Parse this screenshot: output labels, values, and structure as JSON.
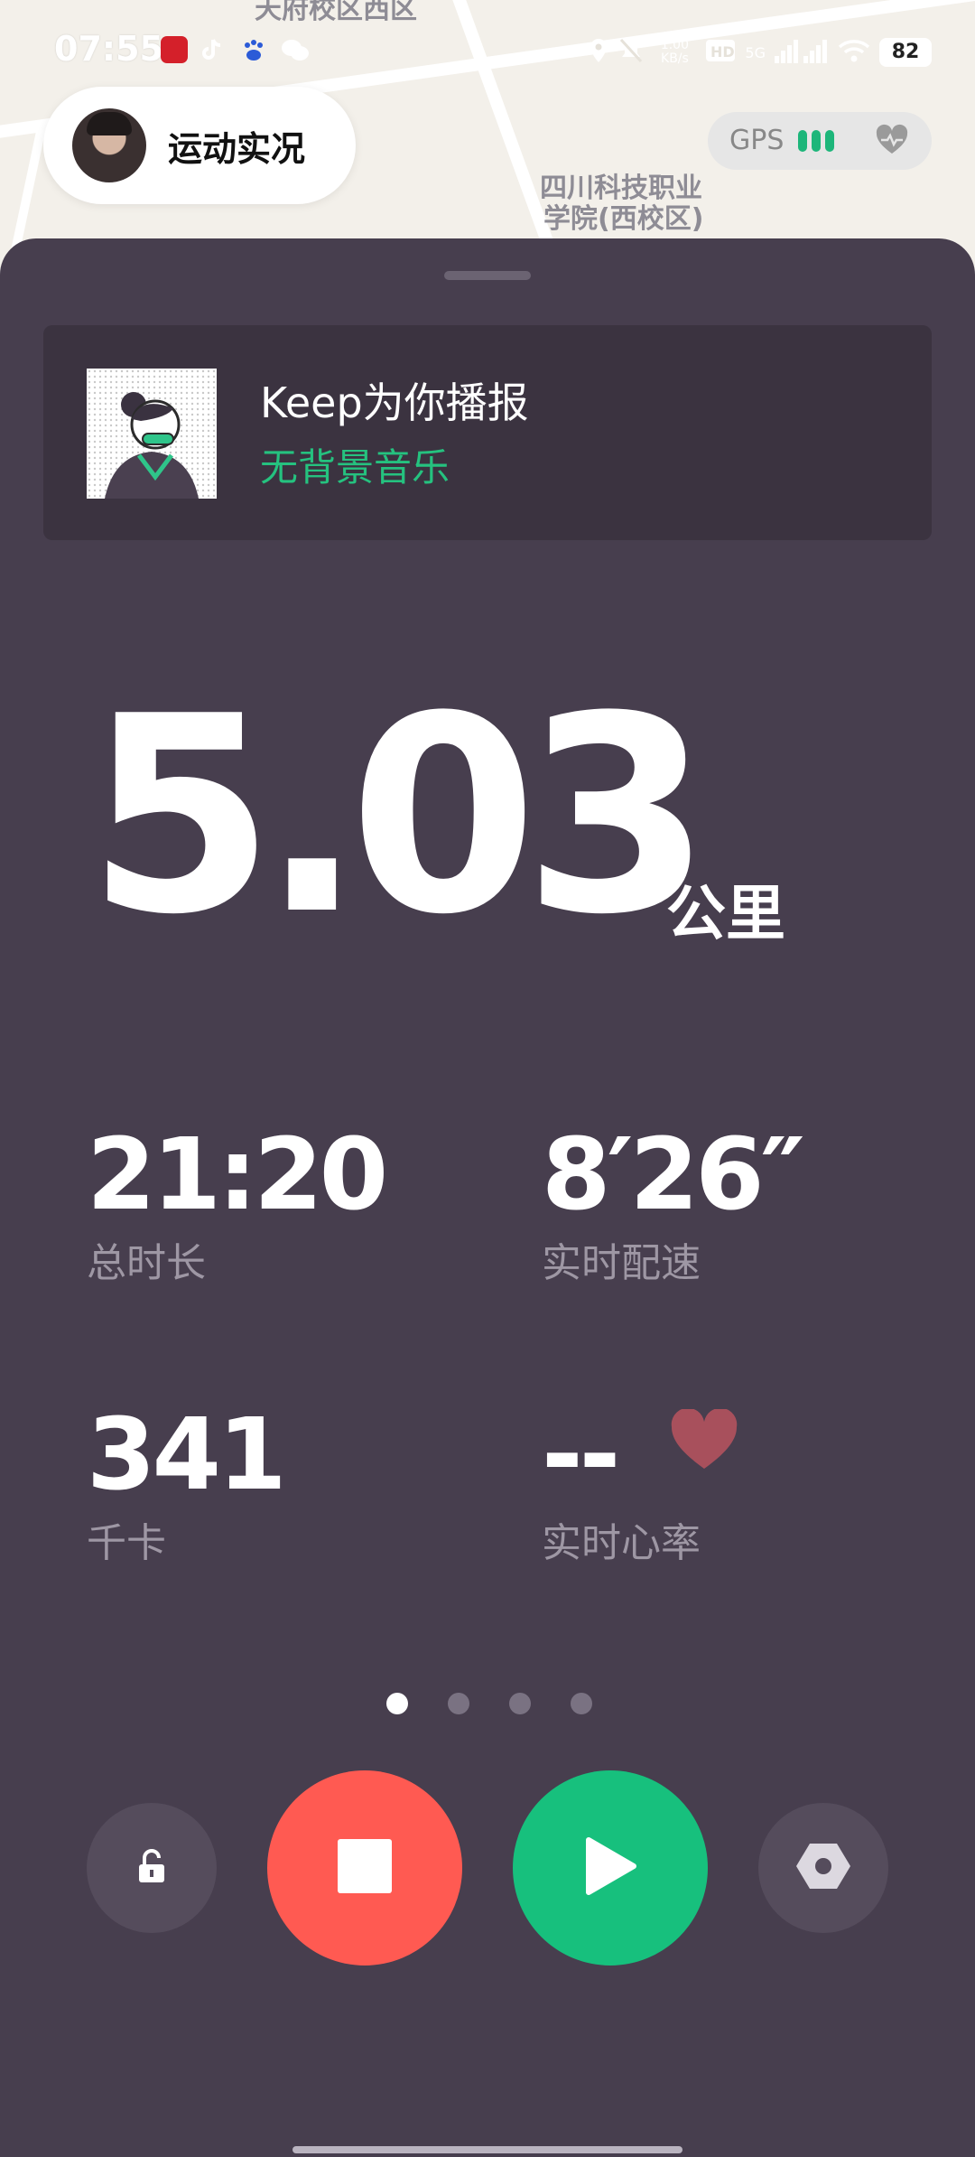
{
  "map": {
    "labels": [
      "天府校区西区",
      "四川科技职业",
      "学院(西校区)"
    ]
  },
  "status_bar": {
    "time": "07:55",
    "network_speed": "1.00 KB/s",
    "network_type": "5G",
    "battery": "82"
  },
  "header": {
    "title": "运动实况",
    "gps_label": "GPS",
    "gps_strength_bars": 3
  },
  "broadcast": {
    "title": "Keep为你播报",
    "subtitle": "无背景音乐"
  },
  "distance": {
    "value": "5.03",
    "unit": "公里"
  },
  "stats": {
    "duration": {
      "value": "21:20",
      "label": "总时长"
    },
    "pace": {
      "value": "8′26″",
      "label": "实时配速"
    },
    "calories": {
      "value": "341",
      "label": "千卡"
    },
    "heart_rate": {
      "value": "--",
      "label": "实时心率"
    }
  },
  "pager": {
    "pages": 4,
    "active_index": 0
  },
  "controls": {
    "lock": "lock-icon",
    "stop": "stop-icon",
    "resume": "play-icon",
    "settings": "settings-icon"
  },
  "colors": {
    "sheet_bg": "#473e4e",
    "accent_green": "#17c07d",
    "stop_red": "#ff5a52",
    "heart": "#a8505c",
    "gps_green": "#1db67a"
  }
}
